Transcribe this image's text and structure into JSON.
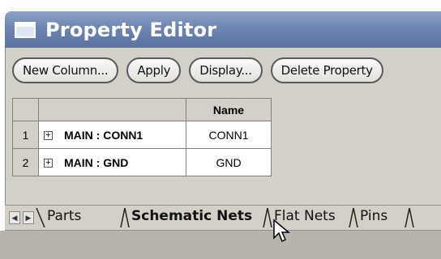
{
  "window": {
    "title": "Property Editor",
    "icon": "window-icon"
  },
  "toolbar": {
    "new_column": "New Column...",
    "apply": "Apply",
    "display": "Display...",
    "delete_property": "Delete Property"
  },
  "grid": {
    "headers": [
      "",
      "Name"
    ],
    "rows": [
      {
        "num": "1",
        "net": "MAIN : CONN1",
        "name": "CONN1"
      },
      {
        "num": "2",
        "net": "MAIN : GND",
        "name": "GND"
      }
    ]
  },
  "tabs": {
    "items": [
      "Parts",
      "Schematic Nets",
      "Flat Nets",
      "Pins"
    ],
    "active": "Schematic Nets"
  },
  "colors": {
    "titlebar": "#6d85b0",
    "panel": "#d4d0c8"
  }
}
